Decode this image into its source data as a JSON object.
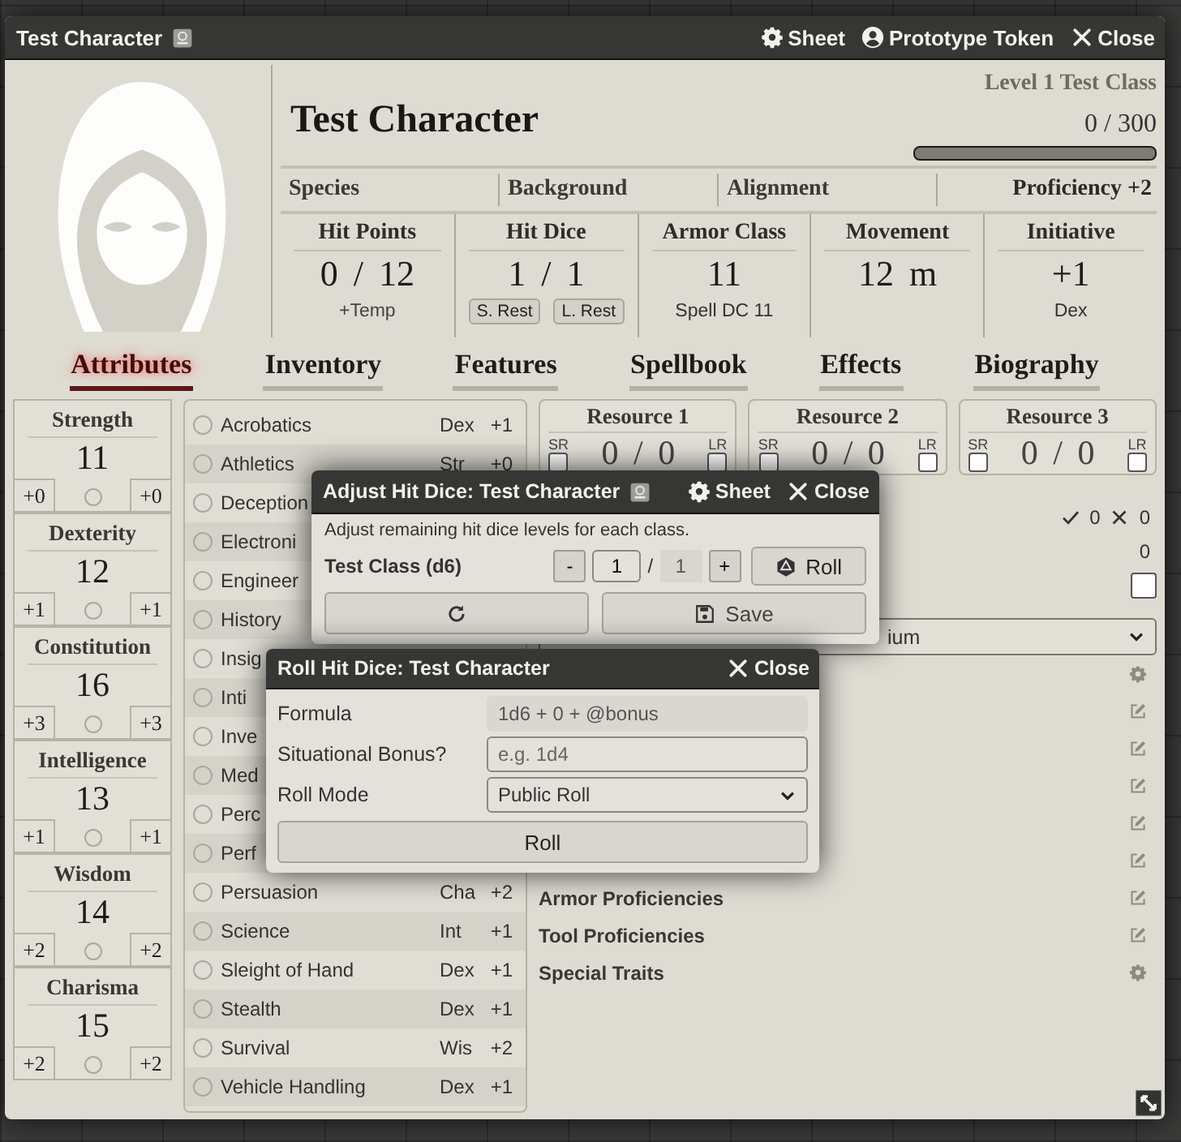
{
  "window": {
    "title": "Test Character",
    "header_buttons": [
      "Sheet",
      "Prototype Token",
      "Close"
    ]
  },
  "character": {
    "name": "Test Character",
    "level_text": "Level 1 Test Class",
    "xp": "0 / 300",
    "xp_bar": {
      "level": 0
    }
  },
  "details": [
    {
      "placeholder": "Species"
    },
    {
      "placeholder": "Background"
    },
    {
      "placeholder": "Alignment"
    }
  ],
  "proficiency": "Proficiency +2",
  "stats": [
    {
      "kind": "hp",
      "title": "Hit Points",
      "value": "0 / 12",
      "temp_placeholder": "+Temp"
    },
    {
      "kind": "dice",
      "title": "Hit Dice",
      "value": "1 / 1",
      "buttons": [
        "S. Rest",
        "L. Rest"
      ]
    },
    {
      "kind": "plain",
      "title": "Armor Class",
      "value": "11",
      "sub": "Spell DC 11"
    },
    {
      "kind": "plain",
      "title": "Movement",
      "value": "12 m"
    },
    {
      "kind": "plain",
      "title": "Initiative",
      "value": "+1",
      "sub": "Dex"
    }
  ],
  "tabs": [
    {
      "label": "Attributes",
      "selected": true
    },
    {
      "label": "Inventory",
      "selected": false
    },
    {
      "label": "Features",
      "selected": false
    },
    {
      "label": "Spellbook",
      "selected": false
    },
    {
      "label": "Effects",
      "selected": false
    },
    {
      "label": "Biography",
      "selected": false
    }
  ],
  "abilities": [
    {
      "name": "Strength",
      "score": "11",
      "mod": "+0",
      "save": "+0",
      "proficient": false
    },
    {
      "name": "Dexterity",
      "score": "12",
      "mod": "+1",
      "save": "+1",
      "proficient": false
    },
    {
      "name": "Constitution",
      "score": "16",
      "mod": "+3",
      "save": "+3",
      "proficient": false
    },
    {
      "name": "Intelligence",
      "score": "13",
      "mod": "+1",
      "save": "+1",
      "proficient": false
    },
    {
      "name": "Wisdom",
      "score": "14",
      "mod": "+2",
      "save": "+2",
      "proficient": false
    },
    {
      "name": "Charisma",
      "score": "15",
      "mod": "+2",
      "save": "+2",
      "proficient": false
    }
  ],
  "skills": [
    {
      "name": "Acrobatics",
      "ability": "Dex",
      "mod": "+1",
      "proficient": false
    },
    {
      "name": "Athletics",
      "ability": "Str",
      "mod": "+0",
      "proficient": false
    },
    {
      "name": "Deception",
      "proficient": false
    },
    {
      "name": "Electroni",
      "proficient": false
    },
    {
      "name": "Engineer",
      "proficient": false
    },
    {
      "name": "History",
      "proficient": false
    },
    {
      "name": "Insig",
      "proficient": false
    },
    {
      "name": "Inti",
      "proficient": false
    },
    {
      "name": "Inve",
      "proficient": false
    },
    {
      "name": "Med",
      "proficient": false
    },
    {
      "name": "Perc",
      "proficient": false
    },
    {
      "name": "Perf",
      "proficient": false
    },
    {
      "name": "Persuasion",
      "ability": "Cha",
      "mod": "+2",
      "proficient": false
    },
    {
      "name": "Science",
      "ability": "Int",
      "mod": "+1",
      "proficient": false
    },
    {
      "name": "Sleight of Hand",
      "ability": "Dex",
      "mod": "+1",
      "proficient": false
    },
    {
      "name": "Stealth",
      "ability": "Dex",
      "mod": "+1",
      "proficient": false
    },
    {
      "name": "Survival",
      "ability": "Wis",
      "mod": "+2",
      "proficient": false
    },
    {
      "name": "Vehicle Handling",
      "ability": "Dex",
      "mod": "+1",
      "proficient": false
    }
  ],
  "resources": [
    {
      "title": "Resource 1",
      "value": "0 / 0",
      "sr_label": "SR",
      "sr": false,
      "lr_label": "LR",
      "lr": false
    },
    {
      "title": "Resource 2",
      "value": "0 / 0",
      "sr_label": "SR",
      "sr": false,
      "lr_label": "LR",
      "lr": false
    },
    {
      "title": "Resource 3",
      "value": "0 / 0",
      "sr_label": "SR",
      "sr": false,
      "lr_label": "LR",
      "lr": false
    }
  ],
  "death_saves": {
    "successes": "0",
    "failures": "0"
  },
  "counter": "0",
  "toggle": {
    "checked": false
  },
  "select": {
    "value": "ium"
  },
  "traits": [
    {
      "kind": "config"
    },
    {
      "kind": "edit"
    },
    {
      "kind": "edit"
    },
    {
      "kind": "edit"
    },
    {
      "kind": "edit"
    },
    {
      "kind": "edit"
    },
    {
      "kind": "edit",
      "label": "Armor Proficiencies"
    },
    {
      "kind": "edit",
      "label": "Tool Proficiencies"
    },
    {
      "kind": "config",
      "label": "Special Traits"
    }
  ],
  "adjust_dialog": {
    "title": "Adjust Hit Dice: Test Character",
    "header_buttons": [
      "Sheet",
      "Close"
    ],
    "hint": "Adjust remaining hit dice levels for each class.",
    "classes": [
      {
        "label": "Test Class (d6)",
        "decrement": "-",
        "value": "1",
        "separator": "/",
        "max": "1",
        "increment": "+",
        "roll": "Roll"
      }
    ],
    "buttons": [
      "Save"
    ]
  },
  "roll_dialog": {
    "title": "Roll Hit Dice: Test Character",
    "close": "Close",
    "fields": [
      {
        "kind": "readonly",
        "label": "Formula",
        "value": "1d6 + 0 + @bonus"
      },
      {
        "kind": "input",
        "label": "Situational Bonus?",
        "placeholder": "e.g. 1d4"
      },
      {
        "kind": "select",
        "label": "Roll Mode",
        "value": "Public Roll"
      }
    ],
    "button": "Roll"
  }
}
